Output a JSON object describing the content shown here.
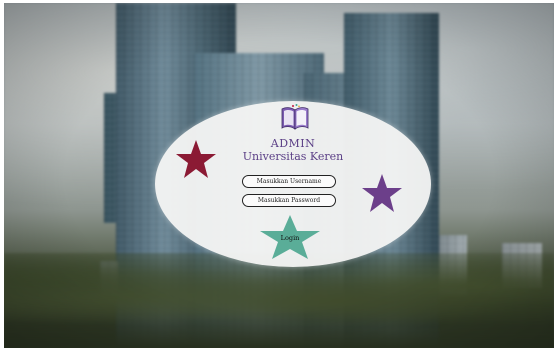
{
  "brand": {
    "title_line1": "ADMIN",
    "title_line2": "Universitas Keren",
    "logo_icon": "open-book-icon"
  },
  "form": {
    "username_placeholder": "Masukkan Username",
    "password_placeholder": "Masukkan Password",
    "login_label": "Login"
  },
  "decorations": {
    "star_left_color": "#8b1a34",
    "star_right_color": "#6c3f8a",
    "login_star_color": "#5aad98"
  },
  "theme": {
    "title_color": "#5b3f86",
    "card_color": "#f7f7f5"
  }
}
